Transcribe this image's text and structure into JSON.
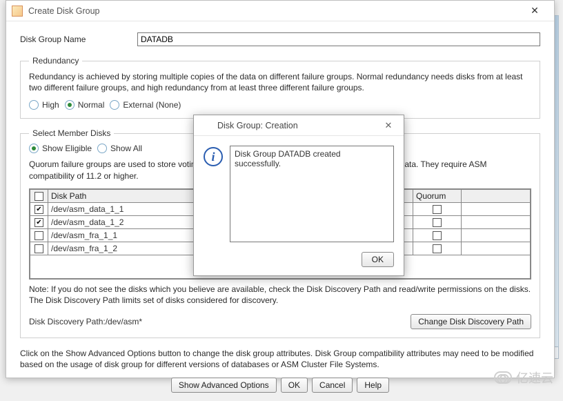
{
  "window": {
    "title": "Create Disk Group"
  },
  "diskGroupName": {
    "label": "Disk Group Name",
    "value": "DATADB"
  },
  "redundancy": {
    "legend": "Redundancy",
    "text": "Redundancy is achieved by storing multiple copies of the data on different failure groups. Normal redundancy needs disks from at least two different failure groups, and high redundancy from at least three different failure groups.",
    "options": {
      "high": "High",
      "normal": "Normal",
      "external": "External (None)"
    },
    "selected": "normal"
  },
  "memberDisks": {
    "legend": "Select Member Disks",
    "showOptions": {
      "eligible": "Show Eligible",
      "all": "Show All"
    },
    "showSelected": "eligible",
    "quorumNote": "Quorum failure groups are used to store voting files in extended clusters and do not contain any user data. They require ASM compatibility of 11.2 or higher.",
    "columns": {
      "diskPath": "Disk Path",
      "group": "roup",
      "quorum": "Quorum"
    },
    "rows": [
      {
        "checked": true,
        "path": "/dev/asm_data_1_1",
        "quorum": false
      },
      {
        "checked": true,
        "path": "/dev/asm_data_1_2",
        "quorum": false
      },
      {
        "checked": false,
        "path": "/dev/asm_fra_1_1",
        "quorum": false
      },
      {
        "checked": false,
        "path": "/dev/asm_fra_1_2",
        "quorum": false
      }
    ],
    "noteBelow": "Note: If you do not see the disks which you believe are available, check the Disk Discovery Path and read/write permissions on the disks. The Disk Discovery Path limits set of disks considered for discovery.",
    "discoveryLabel": "Disk Discovery Path:/dev/asm*",
    "changeBtn": "Change Disk Discovery Path"
  },
  "footerText": "Click on the Show Advanced Options button to change the disk group attributes. Disk Group compatibility attributes may need to be modified based on the usage of disk group for different versions of databases or ASM Cluster File Systems.",
  "buttons": {
    "advanced": "Show Advanced Options",
    "ok": "OK",
    "cancel": "Cancel",
    "help": "Help"
  },
  "modal": {
    "title": "Disk Group: Creation",
    "message": "Disk Group DATADB created successfully.",
    "ok": "OK"
  },
  "watermark": "亿速云"
}
